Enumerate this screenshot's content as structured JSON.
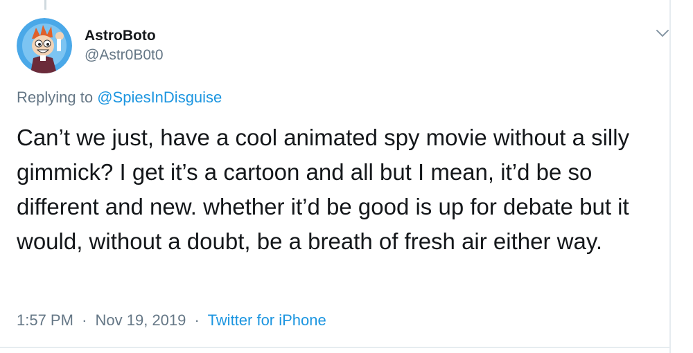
{
  "tweet": {
    "author": {
      "display_name": "AstroBoto",
      "handle": "@Astr0B0t0"
    },
    "replying_prefix": "Replying to",
    "replying_to": "@SpiesInDisguise",
    "text": "Can’t we just, have a cool animated spy movie without a silly gimmick? I get it’s a cartoon and all but I mean, it’d be so different and new. whether it’d be good is up for debate but it would, without a doubt, be a breath of fresh air either way.",
    "time": "1:57 PM",
    "date": "Nov 19, 2019",
    "separator": "·",
    "source": "Twitter for iPhone"
  },
  "icons": {
    "menu": "chevron-down-icon"
  },
  "colors": {
    "link": "#1b95e0",
    "muted": "#657786",
    "text": "#14171a",
    "avatar_bg": "#4aa8e8"
  }
}
